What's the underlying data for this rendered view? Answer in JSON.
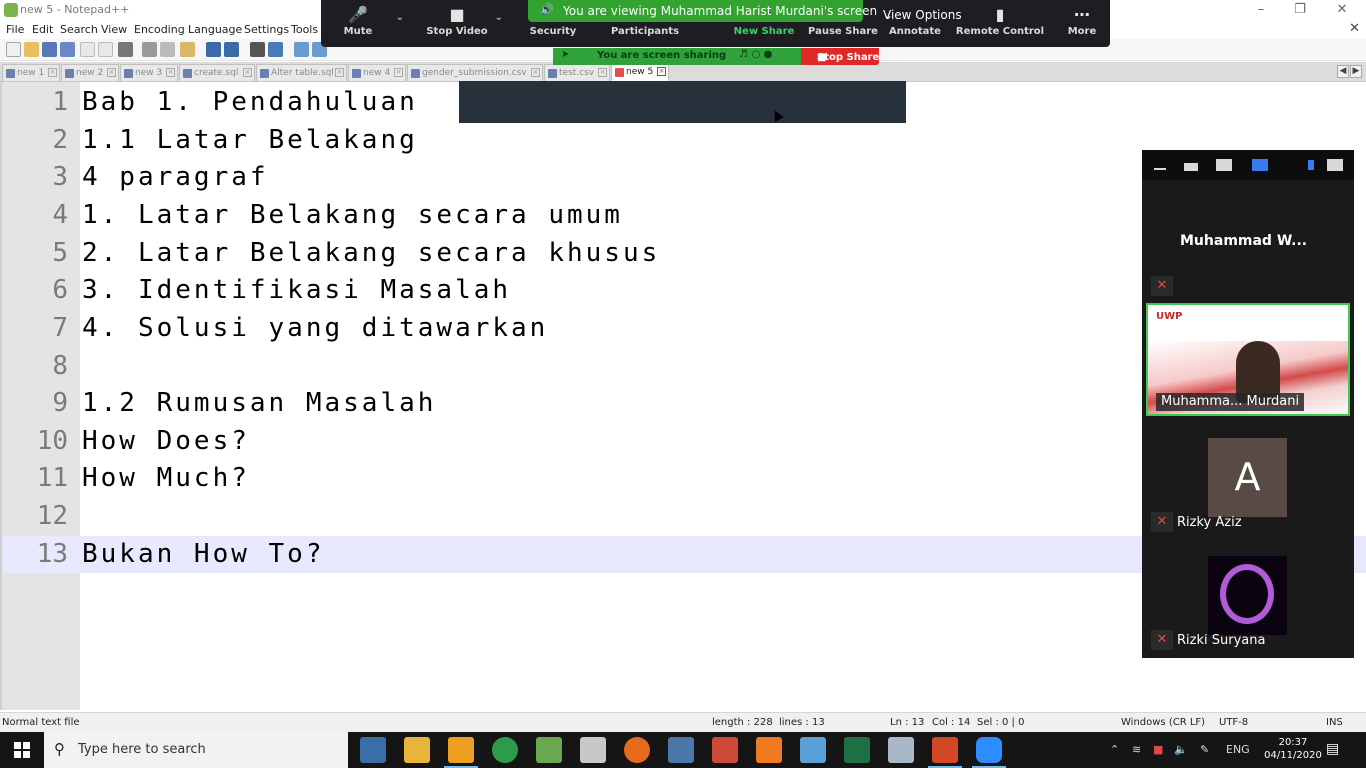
{
  "notepad": {
    "title": "new 5 - Notepad++",
    "menu": [
      "File",
      "Edit",
      "Search",
      "View",
      "Encoding",
      "Language",
      "Settings",
      "Tools"
    ],
    "tabs": [
      {
        "label": "new 1",
        "active": false
      },
      {
        "label": "new 2",
        "active": false
      },
      {
        "label": "new 3",
        "active": false
      },
      {
        "label": "create.sql",
        "active": false
      },
      {
        "label": "Alter table.sql",
        "active": false
      },
      {
        "label": "new 4",
        "active": false
      },
      {
        "label": "gender_submission.csv",
        "active": false
      },
      {
        "label": "test.csv",
        "active": false
      },
      {
        "label": "new 5",
        "active": true
      }
    ],
    "lines": [
      {
        "num": "1",
        "text": "Bab 1. Pendahuluan"
      },
      {
        "num": "2",
        "text": "1.1 Latar Belakang"
      },
      {
        "num": "3",
        "text": "4 paragraf"
      },
      {
        "num": "4",
        "text": "1. Latar Belakang secara umum"
      },
      {
        "num": "5",
        "text": "2. Latar Belakang secara khusus"
      },
      {
        "num": "6",
        "text": "3. Identifikasi Masalah"
      },
      {
        "num": "7",
        "text": "4. Solusi yang ditawarkan"
      },
      {
        "num": "8",
        "text": ""
      },
      {
        "num": "9",
        "text": "1.2 Rumusan Masalah"
      },
      {
        "num": "10",
        "text": "How Does?"
      },
      {
        "num": "11",
        "text": "How Much?"
      },
      {
        "num": "12",
        "text": ""
      },
      {
        "num": "13",
        "text": "Bukan How To?"
      }
    ],
    "current_line": 13,
    "status": {
      "file_type": "Normal text file",
      "length": "length : 228",
      "lines": "lines : 13",
      "ln": "Ln : 13",
      "col": "Col : 14",
      "sel": "Sel : 0 | 0",
      "eol": "Windows (CR LF)",
      "encoding": "UTF-8",
      "mode": "INS"
    }
  },
  "zoom": {
    "toolbar": [
      {
        "label": "Mute",
        "icon": "microphone-icon"
      },
      {
        "label": "Stop Video",
        "icon": "video-camera-icon"
      },
      {
        "label": "Security",
        "icon": "shield-icon"
      },
      {
        "label": "Participants",
        "icon": "participants-icon"
      },
      {
        "label": "New Share",
        "icon": "share-screen-icon"
      },
      {
        "label": "Pause Share",
        "icon": "pause-icon"
      },
      {
        "label": "Annotate",
        "icon": "pencil-icon"
      },
      {
        "label": "Remote Control",
        "icon": "mouse-icon"
      },
      {
        "label": "More",
        "icon": "more-dots-icon"
      }
    ],
    "viewing_banner": "You are viewing Muhammad Harist Murdani's screen",
    "view_options": "View Options",
    "sharing_banner": "You are screen sharing",
    "stop_share": "Stop Share",
    "gallery": {
      "host_name": "Muhammad W...",
      "video_label": "Muhamma... Murdani",
      "video_logo": "UWP",
      "participants": [
        {
          "name": "Rizky Aziz",
          "avatar": "A"
        },
        {
          "name": "Rizki Suryana",
          "avatar": ""
        }
      ]
    },
    "accent_green": "#31a32e",
    "stop_red": "#e02828"
  },
  "taskbar": {
    "search_placeholder": "Type here to search",
    "language": "ENG",
    "time": "20:37",
    "date": "04/11/2020"
  }
}
